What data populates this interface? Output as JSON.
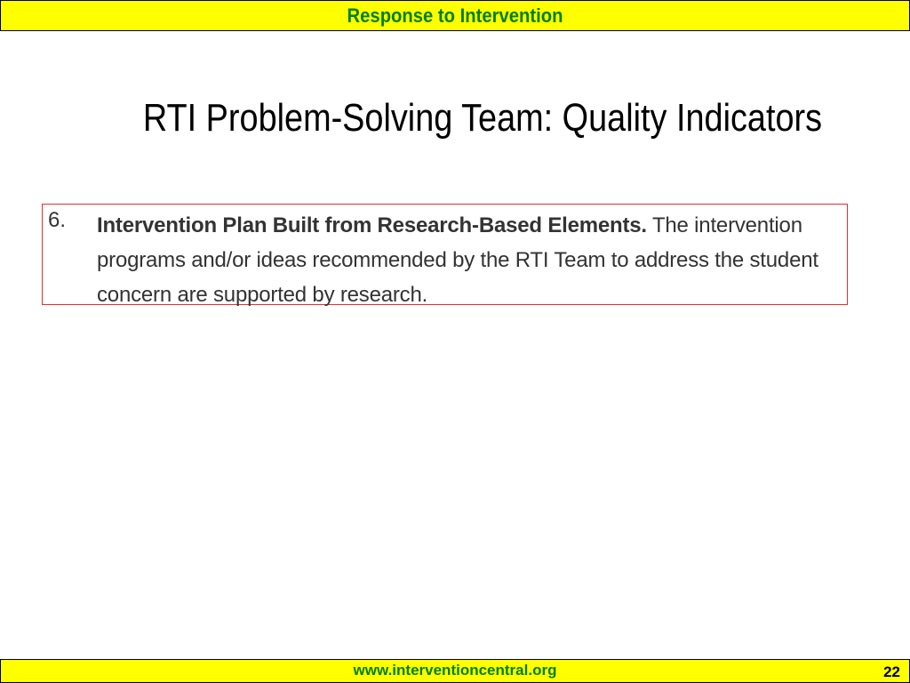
{
  "header": {
    "title": "Response to Intervention"
  },
  "slide": {
    "title": "RTI Problem-Solving Team: Quality Indicators"
  },
  "indicator": {
    "number": "6.",
    "heading": "Intervention Plan Built from Research-Based Elements.",
    "body": "The intervention programs and/or ideas recommended by the RTI Team to address the student concern are supported by research."
  },
  "footer": {
    "url": "www.interventioncentral.org",
    "page_number": "22"
  },
  "colors": {
    "banner": "#ffff00",
    "banner_text": "#008000",
    "box_border": "#e03030"
  }
}
